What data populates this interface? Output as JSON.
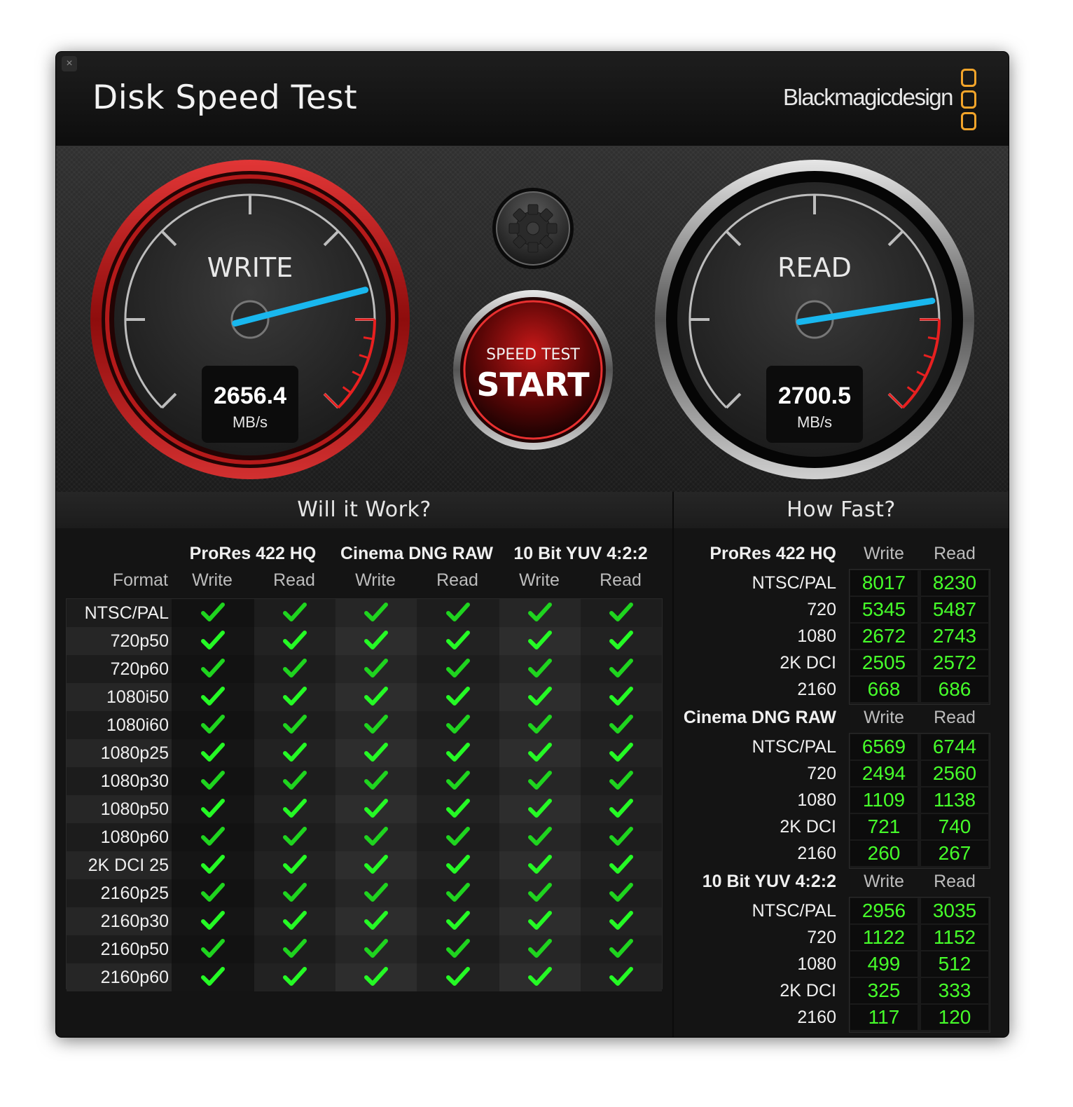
{
  "window": {
    "title": "Disk Speed Test",
    "brand": "Blackmagicdesign",
    "close_icon": "×"
  },
  "write_gauge": {
    "label": "WRITE",
    "value": "2656.4",
    "unit": "MB/s",
    "needle_fraction": 0.78
  },
  "read_gauge": {
    "label": "READ",
    "value": "2700.5",
    "unit": "MB/s",
    "needle_fraction": 0.8
  },
  "start_button": {
    "line1": "SPEED TEST",
    "line2": "START"
  },
  "settings_button": {
    "icon": "gear-icon"
  },
  "will_it_work": {
    "title": "Will it Work?",
    "format_label": "Format",
    "groups": [
      "ProRes 422 HQ",
      "Cinema DNG RAW",
      "10 Bit YUV 4:2:2"
    ],
    "subcols": [
      "Write",
      "Read",
      "Write",
      "Read",
      "Write",
      "Read"
    ],
    "formats": [
      "NTSC/PAL",
      "720p50",
      "720p60",
      "1080i50",
      "1080i60",
      "1080p25",
      "1080p30",
      "1080p50",
      "1080p60",
      "2K DCI 25",
      "2160p25",
      "2160p30",
      "2160p50",
      "2160p60"
    ],
    "all_pass": true
  },
  "how_fast": {
    "title": "How Fast?",
    "write_label": "Write",
    "read_label": "Read",
    "groups": [
      {
        "name": "ProRes 422 HQ",
        "rows": [
          {
            "label": "NTSC/PAL",
            "write": "8017",
            "read": "8230"
          },
          {
            "label": "720",
            "write": "5345",
            "read": "5487"
          },
          {
            "label": "1080",
            "write": "2672",
            "read": "2743"
          },
          {
            "label": "2K DCI",
            "write": "2505",
            "read": "2572"
          },
          {
            "label": "2160",
            "write": "668",
            "read": "686"
          }
        ]
      },
      {
        "name": "Cinema DNG RAW",
        "rows": [
          {
            "label": "NTSC/PAL",
            "write": "6569",
            "read": "6744"
          },
          {
            "label": "720",
            "write": "2494",
            "read": "2560"
          },
          {
            "label": "1080",
            "write": "1109",
            "read": "1138"
          },
          {
            "label": "2K DCI",
            "write": "721",
            "read": "740"
          },
          {
            "label": "2160",
            "write": "260",
            "read": "267"
          }
        ]
      },
      {
        "name": "10 Bit YUV 4:2:2",
        "rows": [
          {
            "label": "NTSC/PAL",
            "write": "2956",
            "read": "3035"
          },
          {
            "label": "720",
            "write": "1122",
            "read": "1152"
          },
          {
            "label": "1080",
            "write": "499",
            "read": "512"
          },
          {
            "label": "2K DCI",
            "write": "325",
            "read": "333"
          },
          {
            "label": "2160",
            "write": "117",
            "read": "120"
          }
        ]
      }
    ]
  },
  "colors": {
    "value_green": "#46ff2a",
    "check_green": "#1fd41f",
    "needle_blue": "#19b7ee",
    "brand_orange": "#f2a42a",
    "write_ring_red": "#c81a1a"
  }
}
